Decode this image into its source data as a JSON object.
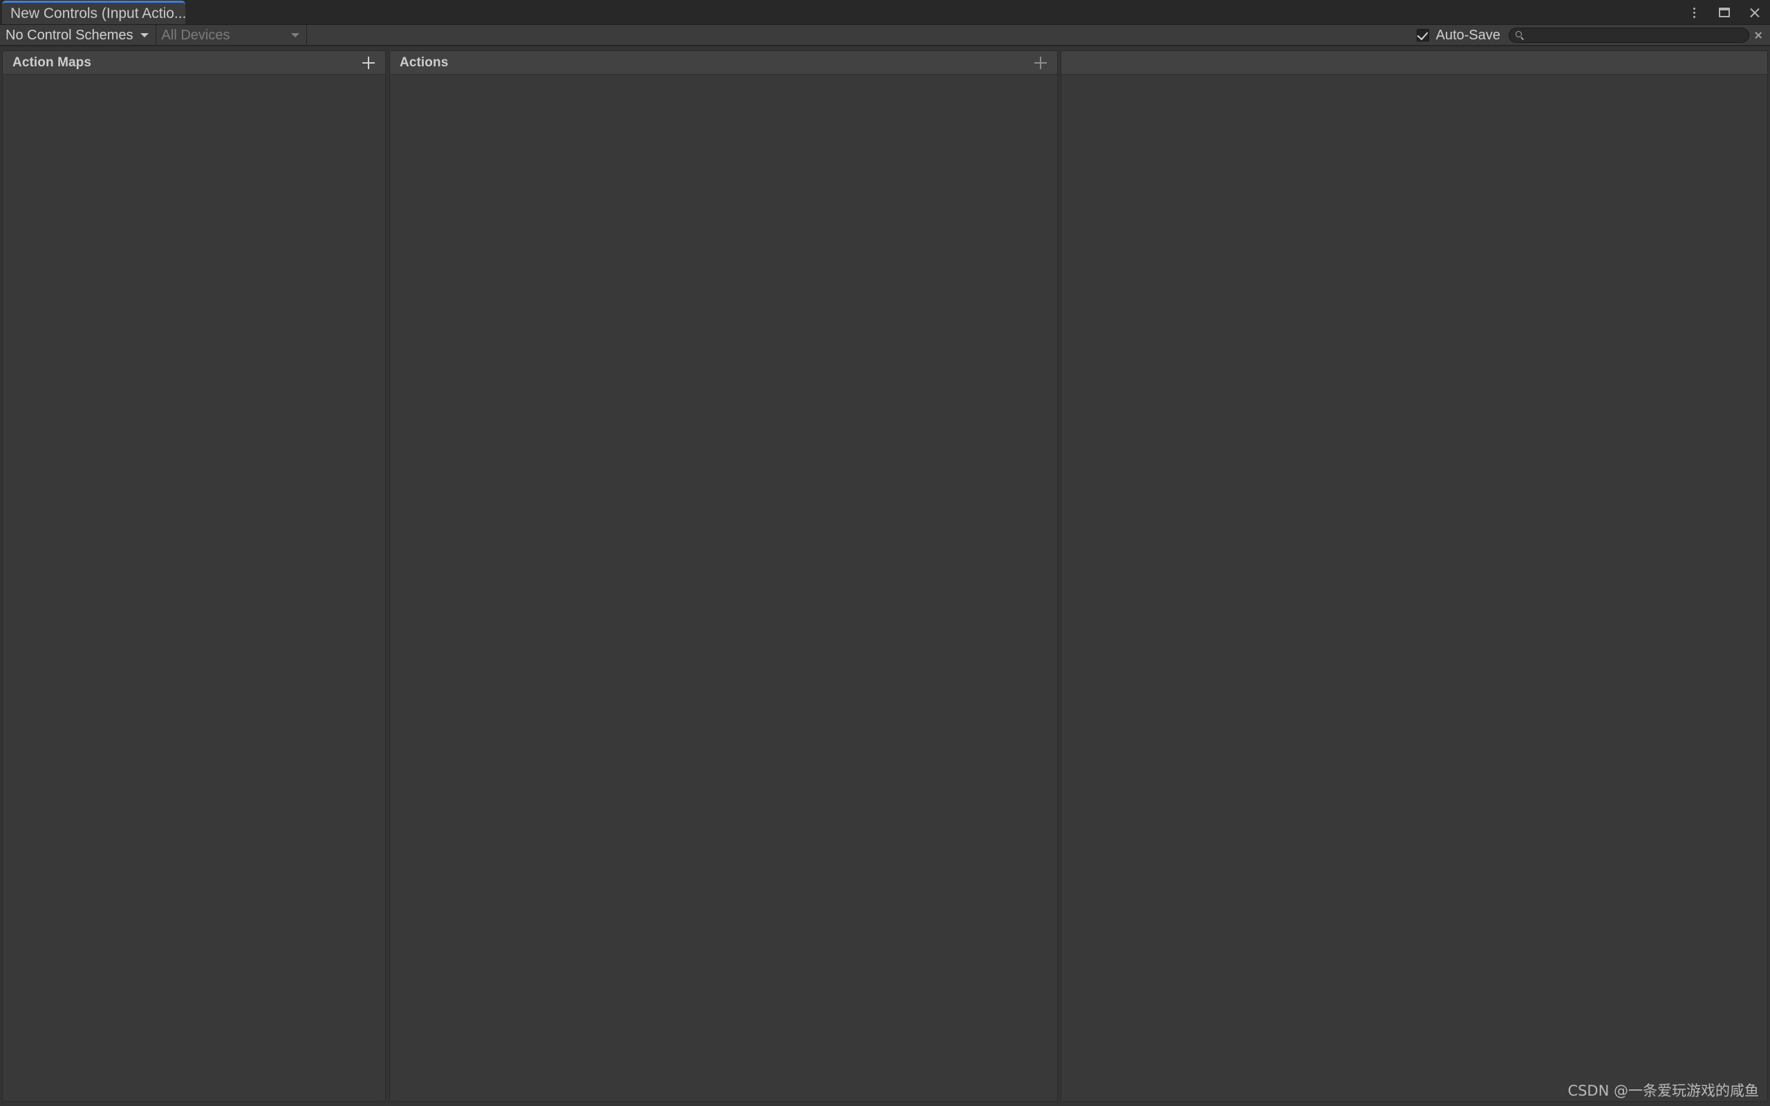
{
  "window": {
    "tab_label": "New Controls (Input Actio...",
    "controls": {
      "menu_icon": "kebab-menu-icon",
      "maximize_icon": "maximize-icon",
      "close_icon": "close-icon"
    },
    "accent_color": "#3f7fd4",
    "titlebar_bg": "#282828"
  },
  "toolbar": {
    "control_schemes_label": "No Control Schemes",
    "devices_label": "All Devices",
    "autosave_label": "Auto-Save",
    "autosave_checked": "✓",
    "search_value": "",
    "search_placeholder": "",
    "search_icon": "search-icon",
    "clear_icon": "close-icon",
    "toolbar_bg": "#3c3c3c"
  },
  "panels": {
    "action_maps": {
      "title": "Action Maps",
      "add_icon": "plus-icon",
      "items": []
    },
    "actions": {
      "title": "Actions",
      "add_icon": "plus-icon",
      "items": []
    },
    "properties": {
      "title": "",
      "items": []
    },
    "panel_bg": "#393939",
    "header_bg": "#424242"
  },
  "watermark": {
    "text": "CSDN @一条爱玩游戏的咸鱼"
  }
}
